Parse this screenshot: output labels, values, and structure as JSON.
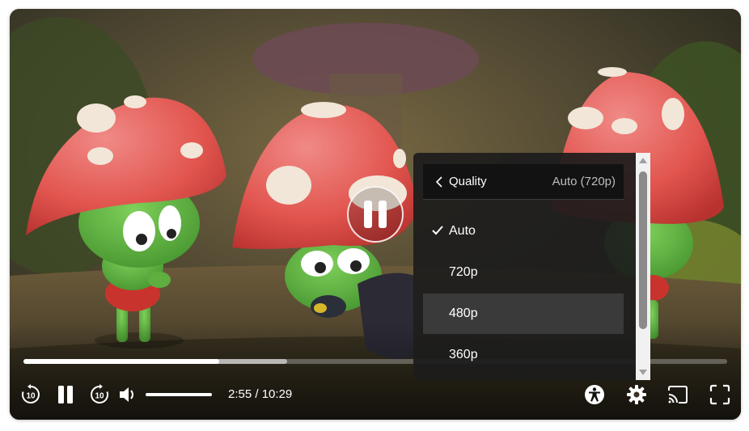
{
  "player": {
    "state": "paused",
    "time": {
      "current": "2:55",
      "total": "10:29",
      "separator": " / "
    },
    "progress": {
      "played_fraction": 0.278,
      "buffered_fraction": 0.375
    },
    "volume_fraction": 1.0,
    "accent_color": "#ffffff",
    "controls": {
      "rewind_icon": "replay-10-icon",
      "rewind_text": "10",
      "play_pause_icon": "pause-icon",
      "forward_icon": "forward-10-icon",
      "forward_text": "10",
      "volume_icon": "volume-icon",
      "accessibility_icon": "accessibility-icon",
      "settings_icon": "gear-icon",
      "cast_icon": "cast-icon",
      "fullscreen_icon": "fullscreen-icon"
    }
  },
  "quality_menu": {
    "title": "Quality",
    "current": "Auto (720p)",
    "back_icon": "chevron-left-icon",
    "options": [
      {
        "label": "Auto",
        "selected": true
      },
      {
        "label": "720p",
        "selected": false
      },
      {
        "label": "480p",
        "selected": false,
        "highlighted": true
      },
      {
        "label": "360p",
        "selected": false
      }
    ]
  }
}
